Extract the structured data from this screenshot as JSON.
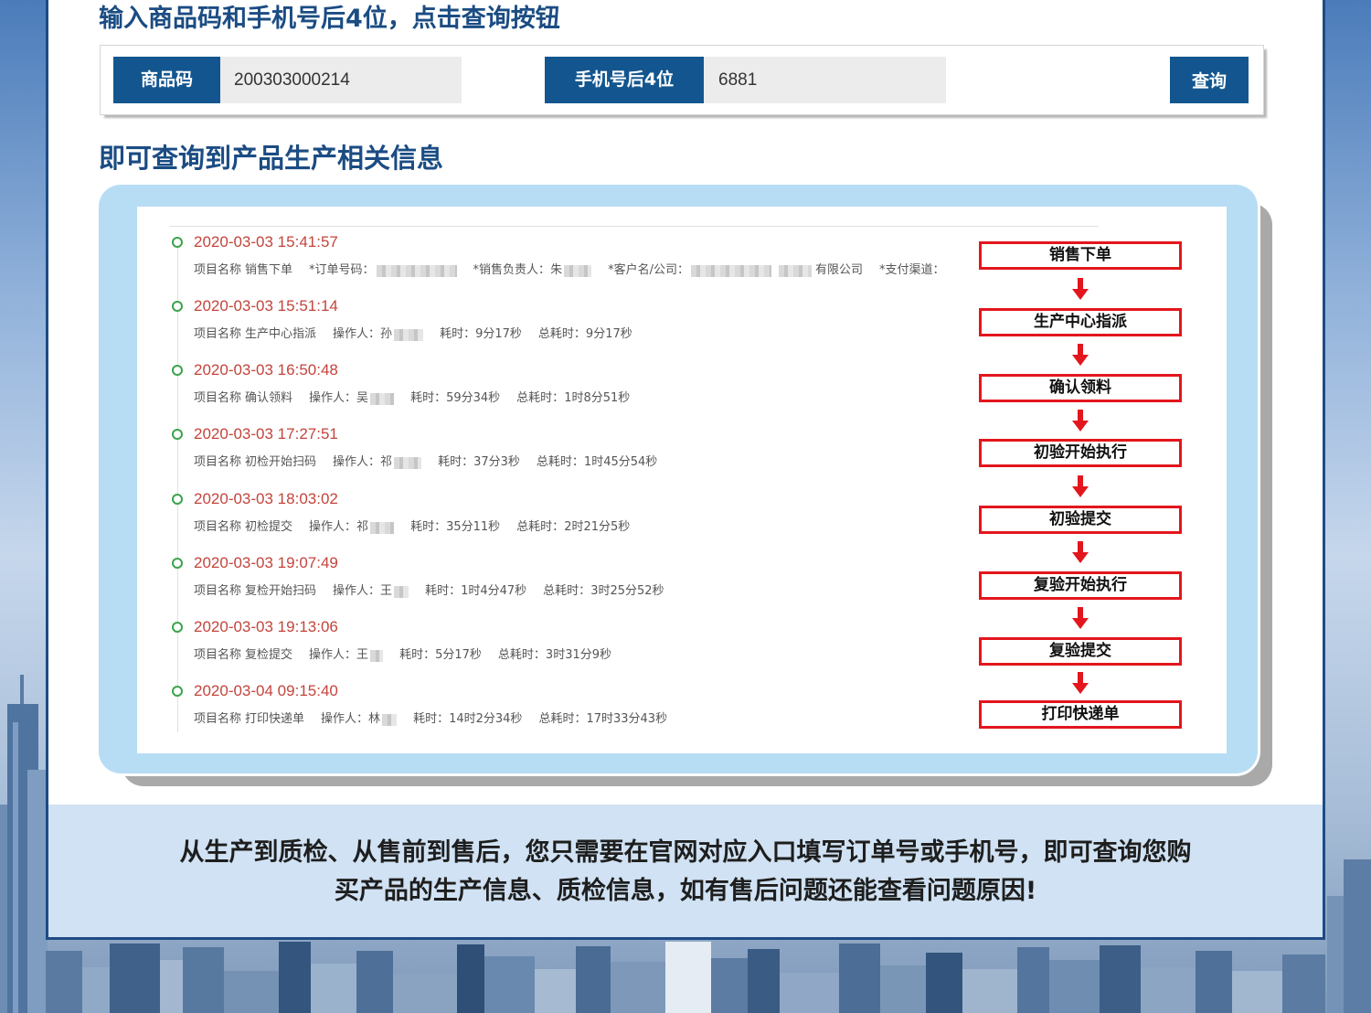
{
  "colors": {
    "brand_blue": "#13568f",
    "heading_blue": "#1b4c83",
    "panel_border": "#1e4b85",
    "input_gray": "#ececec",
    "container_blue": "#b7ddf4",
    "timestamp_red": "#c4443c",
    "node_green": "#3aa34a",
    "flow_red": "#e3161d",
    "band_blue": "#d0e2f3"
  },
  "icons": {
    "timeline_node": "circle-outline-icon",
    "flow_connector": "arrow-down-icon"
  },
  "query": {
    "heading": "输入商品码和手机号后4位，点击查询按钮",
    "product_code_label": "商品码",
    "product_code_value": "200303000214",
    "phone_label": "手机号后4位",
    "phone_value": "6881",
    "submit_label": "查询"
  },
  "results": {
    "heading": "即可查询到产品生产相关信息",
    "timeline": [
      {
        "time": "2020-03-03 15:41:57",
        "project_label": "项目名称",
        "project": "销售下单",
        "order_no_label": "*订单号码：",
        "sales_rep_label": "*销售负责人：",
        "sales_rep_initial": "朱",
        "customer_label": "*客户名/公司：",
        "customer_suffix": "有限公司",
        "payment_label": "*支付渠道："
      },
      {
        "time": "2020-03-03 15:51:14",
        "project_label": "项目名称",
        "project": "生产中心指派",
        "operator_label": "操作人：",
        "operator_initial": "孙",
        "duration_label": "耗时：",
        "duration": "9分17秒",
        "total_label": "总耗时：",
        "total": "9分17秒"
      },
      {
        "time": "2020-03-03 16:50:48",
        "project_label": "项目名称",
        "project": "确认领料",
        "operator_label": "操作人：",
        "operator_initial": "吴",
        "duration_label": "耗时：",
        "duration": "59分34秒",
        "total_label": "总耗时：",
        "total": "1时8分51秒"
      },
      {
        "time": "2020-03-03 17:27:51",
        "project_label": "项目名称",
        "project": "初检开始扫码",
        "operator_label": "操作人：",
        "operator_initial": "祁",
        "duration_label": "耗时：",
        "duration": "37分3秒",
        "total_label": "总耗时：",
        "total": "1时45分54秒"
      },
      {
        "time": "2020-03-03 18:03:02",
        "project_label": "项目名称",
        "project": "初检提交",
        "operator_label": "操作人：",
        "operator_initial": "祁",
        "duration_label": "耗时：",
        "duration": "35分11秒",
        "total_label": "总耗时：",
        "total": "2时21分5秒"
      },
      {
        "time": "2020-03-03 19:07:49",
        "project_label": "项目名称",
        "project": "复检开始扫码",
        "operator_label": "操作人：",
        "operator_initial": "王",
        "duration_label": "耗时：",
        "duration": "1时4分47秒",
        "total_label": "总耗时：",
        "total": "3时25分52秒"
      },
      {
        "time": "2020-03-03 19:13:06",
        "project_label": "项目名称",
        "project": "复检提交",
        "operator_label": "操作人：",
        "operator_initial": "王",
        "duration_label": "耗时：",
        "duration": "5分17秒",
        "total_label": "总耗时：",
        "total": "3时31分9秒"
      },
      {
        "time": "2020-03-04 09:15:40",
        "project_label": "项目名称",
        "project": "打印快递单",
        "operator_label": "操作人：",
        "operator_initial": "林",
        "duration_label": "耗时：",
        "duration": "14时2分34秒",
        "total_label": "总耗时：",
        "total": "17时33分43秒"
      }
    ],
    "flow_steps": [
      "销售下单",
      "生产中心指派",
      "确认领料",
      "初验开始执行",
      "初验提交",
      "复验开始执行",
      "复验提交",
      "打印快递单"
    ]
  },
  "footer": {
    "line1": "从生产到质检、从售前到售后，您只需要在官网对应入口填写订单号或手机号，即可查询您购",
    "line2": "买产品的生产信息、质检信息，如有售后问题还能查看问题原因!"
  }
}
